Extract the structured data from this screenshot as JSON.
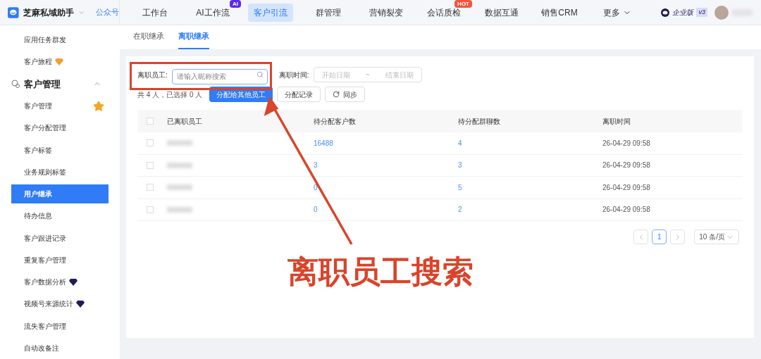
{
  "app": {
    "name": "芝麻私域助手",
    "account_link": "公众号"
  },
  "nav": [
    {
      "label": "工作台",
      "selected": false
    },
    {
      "label": "AI工作流",
      "selected": false,
      "tag": {
        "text": "AI",
        "color": "#5b2bf0"
      }
    },
    {
      "label": "客户引流",
      "selected": true
    },
    {
      "label": "群管理",
      "selected": false
    },
    {
      "label": "营销裂变",
      "selected": false
    },
    {
      "label": "会话质检",
      "selected": false,
      "tag": {
        "text": "HOT",
        "color": "#f5533d"
      }
    },
    {
      "label": "数据互通",
      "selected": false
    },
    {
      "label": "销售CRM",
      "selected": false
    },
    {
      "label": "更多",
      "selected": false,
      "dropdown": true
    }
  ],
  "edition": {
    "label": "企业版",
    "version": "v3"
  },
  "sidebar": [
    {
      "kind": "item",
      "label": "应用任务群发",
      "selected": false
    },
    {
      "kind": "item",
      "label": "客户旅程",
      "selected": false,
      "badge": {
        "kind": "gem",
        "color": "#f0a12e"
      }
    },
    {
      "kind": "section",
      "label": "客户管理",
      "expanded": true
    },
    {
      "kind": "item",
      "label": "客户管理",
      "selected": false,
      "badge": {
        "kind": "star",
        "color": "#f5a623"
      }
    },
    {
      "kind": "item",
      "label": "客户分配管理",
      "selected": false
    },
    {
      "kind": "item",
      "label": "客户标签",
      "selected": false
    },
    {
      "kind": "item",
      "label": "业务规则标签",
      "selected": false
    },
    {
      "kind": "item",
      "label": "用户继承",
      "selected": true
    },
    {
      "kind": "item",
      "label": "待办信息",
      "selected": false
    },
    {
      "kind": "item",
      "label": "客户跟进记录",
      "selected": false
    },
    {
      "kind": "item",
      "label": "重复客户管理",
      "selected": false
    },
    {
      "kind": "item",
      "label": "客户数据分析",
      "selected": false,
      "badge": {
        "kind": "gem",
        "color": "#1e1b5a"
      }
    },
    {
      "kind": "item",
      "label": "视频号来源统计",
      "selected": false,
      "badge": {
        "kind": "gem",
        "color": "#1e1b5a"
      }
    },
    {
      "kind": "item",
      "label": "流失客户管理",
      "selected": false
    },
    {
      "kind": "item",
      "label": "自动改备注",
      "selected": false
    }
  ],
  "tabs": [
    {
      "label": "在职继承",
      "selected": false
    },
    {
      "label": "离职继承",
      "selected": true
    }
  ],
  "filters": {
    "employee_label": "离职员工:",
    "employee_placeholder": "请输入昵称搜索",
    "time_label": "离职时间:",
    "start_placeholder": "开始日期",
    "separator": "~",
    "end_placeholder": "结束日期"
  },
  "summary": "共 4 人，已选择 0 人",
  "buttons": [
    {
      "kind": "primary",
      "label": "分配给其他员工"
    },
    {
      "kind": "default",
      "label": "分配记录"
    },
    {
      "kind": "sync",
      "label": "同步"
    }
  ],
  "table": {
    "all_checked": false,
    "columns": [
      "已离职员工",
      "待分配客户数",
      "待分配群聊数",
      "离职时间"
    ],
    "rows": [
      {
        "checked": false,
        "customers": "16488",
        "groups": "4",
        "time": "26-04-29 09:58"
      },
      {
        "checked": false,
        "customers": "3",
        "groups": "3",
        "time": "26-04-29 09:58"
      },
      {
        "checked": false,
        "customers": "0",
        "groups": "5",
        "time": "26-04-29 09:58"
      },
      {
        "checked": false,
        "customers": "0",
        "groups": "2",
        "time": "26-04-29 09:58"
      }
    ]
  },
  "pagination": {
    "pages": [
      {
        "label": "1",
        "selected": true
      }
    ],
    "page_size": "10 条/页"
  },
  "annotation": {
    "text": "离职员工搜索"
  }
}
